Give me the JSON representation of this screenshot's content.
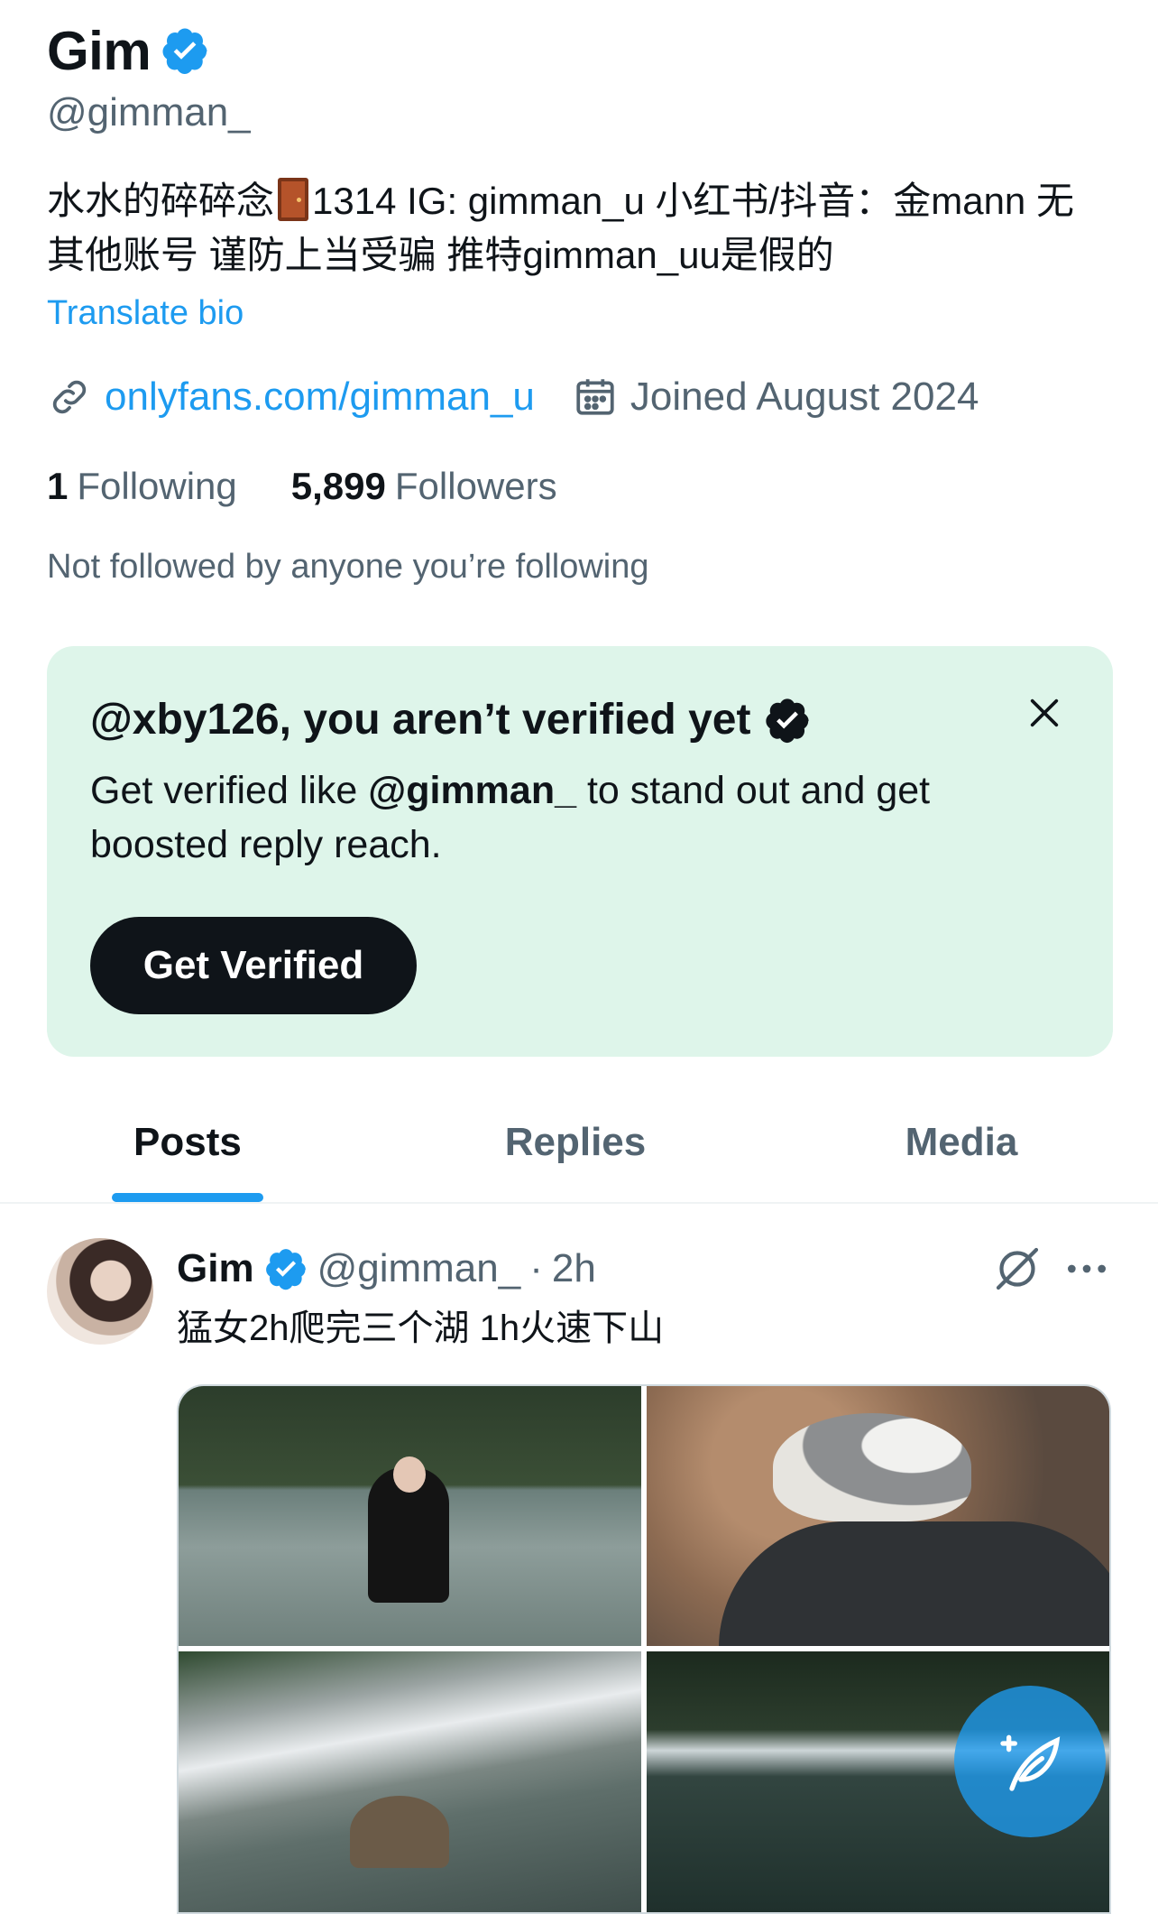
{
  "profile": {
    "name": "Gim",
    "handle": "@gimman_",
    "bio_part1": "水水的碎碎念",
    "bio_part2": "1314 IG: gimman_u 小红书/抖音：金mann 无其他账号 谨防上当受骗 推特gimman_uu是假的",
    "translate_label": "Translate bio",
    "link": "onlyfans.com/gimman_u",
    "joined": "Joined August 2024",
    "following_count": "1",
    "following_label": "Following",
    "followers_count": "5,899",
    "followers_label": "Followers",
    "not_followed": "Not followed by anyone you’re following"
  },
  "verify_card": {
    "title": "@xby126, you aren’t verified yet",
    "body_prefix": "Get verified like ",
    "body_handle": "@gimman_",
    "body_suffix": " to stand out and get boosted reply reach.",
    "button_label": "Get Verified"
  },
  "tabs": [
    {
      "label": "Posts",
      "active": true
    },
    {
      "label": "Replies",
      "active": false
    },
    {
      "label": "Media",
      "active": false
    }
  ],
  "post": {
    "name": "Gim",
    "handle": "@gimman_",
    "dot": "·",
    "time": "2h",
    "text": "猛女2h爬完三个湖 1h火速下山"
  },
  "colors": {
    "accent": "#1d9bf0",
    "text_primary": "#0f1419",
    "text_secondary": "#536471",
    "verify_card_bg": "#def5ea"
  },
  "icons": [
    "verified-badge-icon",
    "link-icon",
    "calendar-icon",
    "close-icon",
    "grok-icon",
    "more-icon",
    "compose-icon"
  ]
}
